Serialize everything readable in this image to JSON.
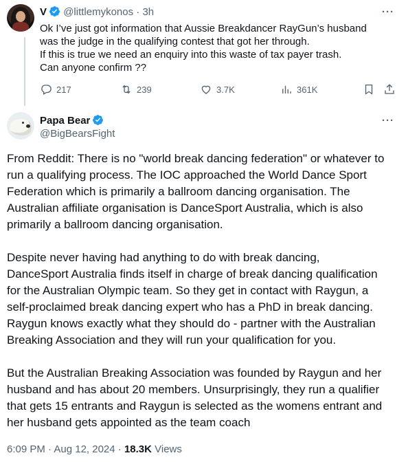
{
  "parent_tweet": {
    "name": "V",
    "handle": "@littlemykonos",
    "time": "3h",
    "lines": [
      "Ok I’ve just got information that Aussie Breakdancer RayGun’s husband",
      "was the judge in the qualifying contest that got her through.",
      "If this is true we need an enquiry into this waste of tax payer trash.",
      "Can anyone confirm ??"
    ],
    "replies": "217",
    "retweets": "239",
    "likes": "3.7K",
    "views": "361K"
  },
  "main_tweet": {
    "name": "Papa Bear",
    "handle": "@BigBearsFight",
    "paragraphs": [
      [
        "From Reddit: There is no \"world break dancing federation\" or whatever to",
        "run a qualifying process. The IOC approached the World Dance Sport",
        "Federation which is primarily a ballroom dancing organisation. The",
        "Australian affiliate organisation is DanceSport Australia, which is also",
        "primarily a ballroom dancing organisation."
      ],
      [
        "Despite never having had anything to do with break dancing,",
        "DanceSport Australia finds itself in charge of break dancing qualification",
        "for the Australian Olympic team. So they get in contact with Raygun, a",
        "self-proclaimed break dancing expert who has a PhD in break dancing.",
        "Raygun knows exactly what they should do - partner with the Australian",
        "Breaking Association and they will run your qualification for you."
      ],
      [
        "But the Australian Breaking Association was founded by Raygun and her",
        "husband and has about 20 members. Unsurprisingly, they run a qualifier",
        "that gets 15 entrants and Raygun is selected as the womens entrant and",
        "her husband gets appointed as the team coach"
      ]
    ],
    "timestamp": "6:09 PM · Aug 12, 2024 · ",
    "views_count": "18.3K",
    "views_label": " Views"
  },
  "colors": {
    "verified": "#1d9bf0",
    "muted": "#536471",
    "text": "#0f1419"
  }
}
